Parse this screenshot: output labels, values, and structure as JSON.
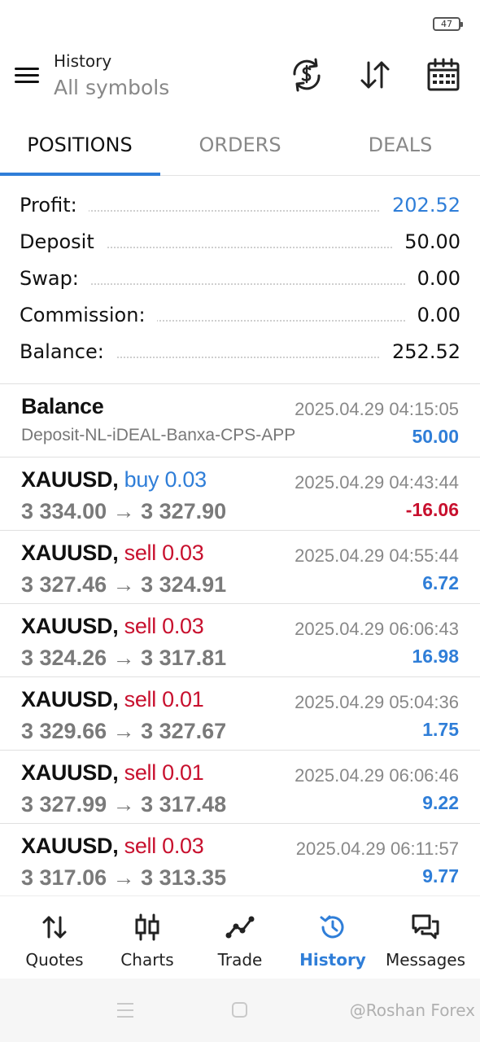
{
  "status": {
    "battery": "47"
  },
  "header": {
    "title": "History",
    "subtitle": "All symbols"
  },
  "tabs": [
    {
      "label": "POSITIONS",
      "active": true
    },
    {
      "label": "ORDERS",
      "active": false
    },
    {
      "label": "DEALS",
      "active": false
    }
  ],
  "summary": {
    "profit_label": "Profit:",
    "profit": "202.52",
    "deposit_label": "Deposit",
    "deposit": "50.00",
    "swap_label": "Swap:",
    "swap": "0.00",
    "commission_label": "Commission:",
    "commission": "0.00",
    "balance_label": "Balance:",
    "balance": "252.52"
  },
  "balance_entry": {
    "title": "Balance",
    "comment": "Deposit-NL-iDEAL-Banxa-CPS-APP",
    "time": "2025.04.29 04:15:05",
    "amount": "50.00"
  },
  "positions": [
    {
      "symbol": "XAUUSD,",
      "direction": "buy 0.03",
      "side": "buy",
      "prices": "3 334.00 → 3 327.90",
      "time": "2025.04.29 04:43:44",
      "profit": "-16.06"
    },
    {
      "symbol": "XAUUSD,",
      "direction": "sell 0.03",
      "side": "sell",
      "prices": "3 327.46 → 3 324.91",
      "time": "2025.04.29 04:55:44",
      "profit": "6.72"
    },
    {
      "symbol": "XAUUSD,",
      "direction": "sell 0.03",
      "side": "sell",
      "prices": "3 324.26 → 3 317.81",
      "time": "2025.04.29 06:06:43",
      "profit": "16.98"
    },
    {
      "symbol": "XAUUSD,",
      "direction": "sell 0.01",
      "side": "sell",
      "prices": "3 329.66 → 3 327.67",
      "time": "2025.04.29 05:04:36",
      "profit": "1.75"
    },
    {
      "symbol": "XAUUSD,",
      "direction": "sell 0.01",
      "side": "sell",
      "prices": "3 327.99 → 3 317.48",
      "time": "2025.04.29 06:06:46",
      "profit": "9.22"
    },
    {
      "symbol": "XAUUSD,",
      "direction": "sell 0.03",
      "side": "sell",
      "prices": "3 317.06 → 3 313.35",
      "time": "2025.04.29 06:11:57",
      "profit": "9.77"
    }
  ],
  "bottom_nav": [
    {
      "label": "Quotes",
      "icon": "quotes-arrows-icon",
      "active": false
    },
    {
      "label": "Charts",
      "icon": "candlestick-icon",
      "active": false
    },
    {
      "label": "Trade",
      "icon": "trend-line-icon",
      "active": false
    },
    {
      "label": "History",
      "icon": "history-clock-icon",
      "active": true
    },
    {
      "label": "Messages",
      "icon": "chat-bubbles-icon",
      "active": false
    }
  ],
  "watermark": "@Roshan Forex",
  "colors": {
    "accent": "#2f7ed8",
    "negative": "#c8102e",
    "muted": "#888888"
  }
}
